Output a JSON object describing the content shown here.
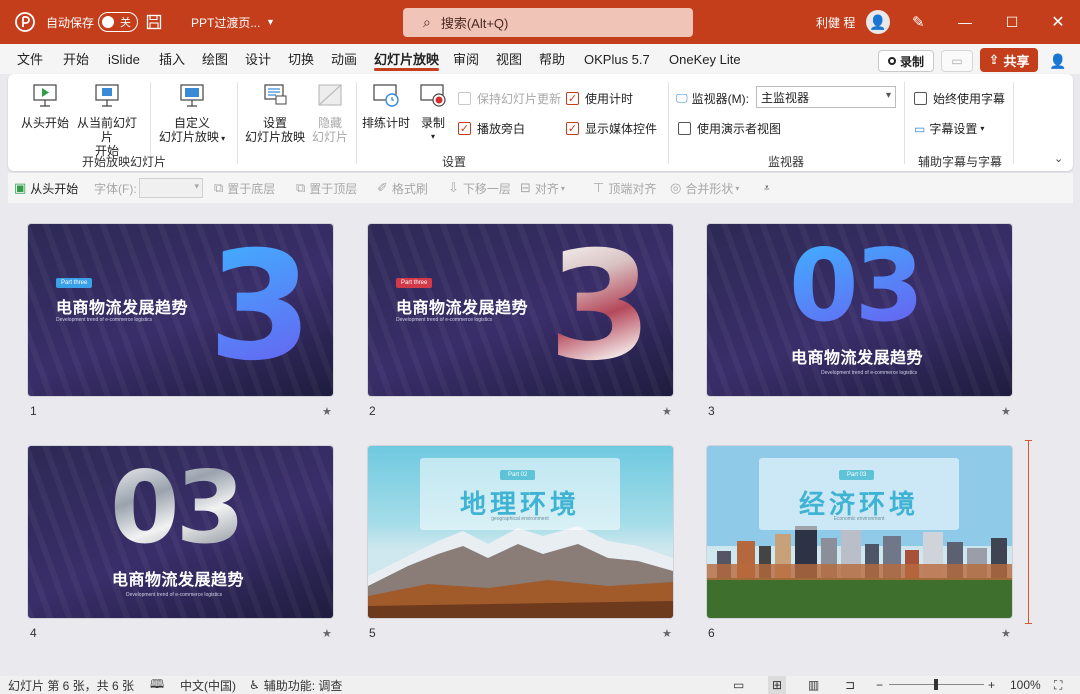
{
  "titlebar": {
    "autosave_label": "自动保存",
    "autosave_state": "关",
    "doc_title": "PPT过渡页...",
    "search_placeholder": "搜索(Alt+Q)",
    "user_name": "利健 程",
    "bg_color": "#c43e1c"
  },
  "menu": {
    "tabs": [
      "文件",
      "开始",
      "iSlide",
      "插入",
      "绘图",
      "设计",
      "切换",
      "动画",
      "幻灯片放映",
      "审阅",
      "视图",
      "帮助",
      "OKPlus 5.7",
      "OneKey Lite"
    ],
    "active_tab": "幻灯片放映",
    "record_label": "录制",
    "share_label": "共享"
  },
  "ribbon": {
    "group1": {
      "label": "开始放映幻灯片",
      "from_start": "从头开始",
      "from_current_1": "从当前幻灯片",
      "from_current_2": "开始",
      "custom_1": "自定义",
      "custom_2": "幻灯片放映"
    },
    "group2": {
      "label": "设置",
      "setup_1": "设置",
      "setup_2": "幻灯片放映",
      "hide_1": "隐藏",
      "hide_2": "幻灯片",
      "rehearse": "排练计时",
      "record": "录制",
      "keep_updated": "保持幻灯片更新",
      "play_narration": "播放旁白",
      "use_timings": "使用计时",
      "show_media_controls": "显示媒体控件"
    },
    "group3": {
      "label": "监视器",
      "monitor_label": "监视器(M):",
      "monitor_value": "主监视器",
      "presenter_view": "使用演示者视图"
    },
    "group4": {
      "label": "辅助字幕与字幕",
      "always_subtitles": "始终使用字幕",
      "subtitle_settings": "字幕设置"
    }
  },
  "qat": {
    "from_start": "从头开始",
    "font": "字体(F):",
    "send_to_back": "置于底层",
    "bring_to_front": "置于顶层",
    "format_painter": "格式刷",
    "move_down": "下移一层",
    "align": "对齐",
    "align_top": "顶端对齐",
    "merge_shapes": "合并形状"
  },
  "slides": [
    {
      "num": "1",
      "tag": "Part three",
      "title": "电商物流发展趋势",
      "subtitle": "Development trend of e-commerce logistics",
      "big": "3"
    },
    {
      "num": "2",
      "tag": "Part three",
      "title": "电商物流发展趋势",
      "subtitle": "Development trend of e-commerce logistics",
      "big": "3"
    },
    {
      "num": "3",
      "title": "电商物流发展趋势",
      "subtitle": "Development trend of e-commerce logistics",
      "big": "03"
    },
    {
      "num": "4",
      "title": "电商物流发展趋势",
      "subtitle": "Development trend of e-commerce logistics",
      "big": "03"
    },
    {
      "num": "5",
      "tag": "Part 02",
      "title": "地理环境",
      "subtitle": "geographical environment"
    },
    {
      "num": "6",
      "tag": "Part 03",
      "title": "经济环境",
      "subtitle": "Economic environment"
    }
  ],
  "status": {
    "slide_info": "幻灯片 第 6 张，共 6 张",
    "language": "中文(中国)",
    "accessibility": "辅助功能: 调查",
    "zoom": "100%"
  }
}
